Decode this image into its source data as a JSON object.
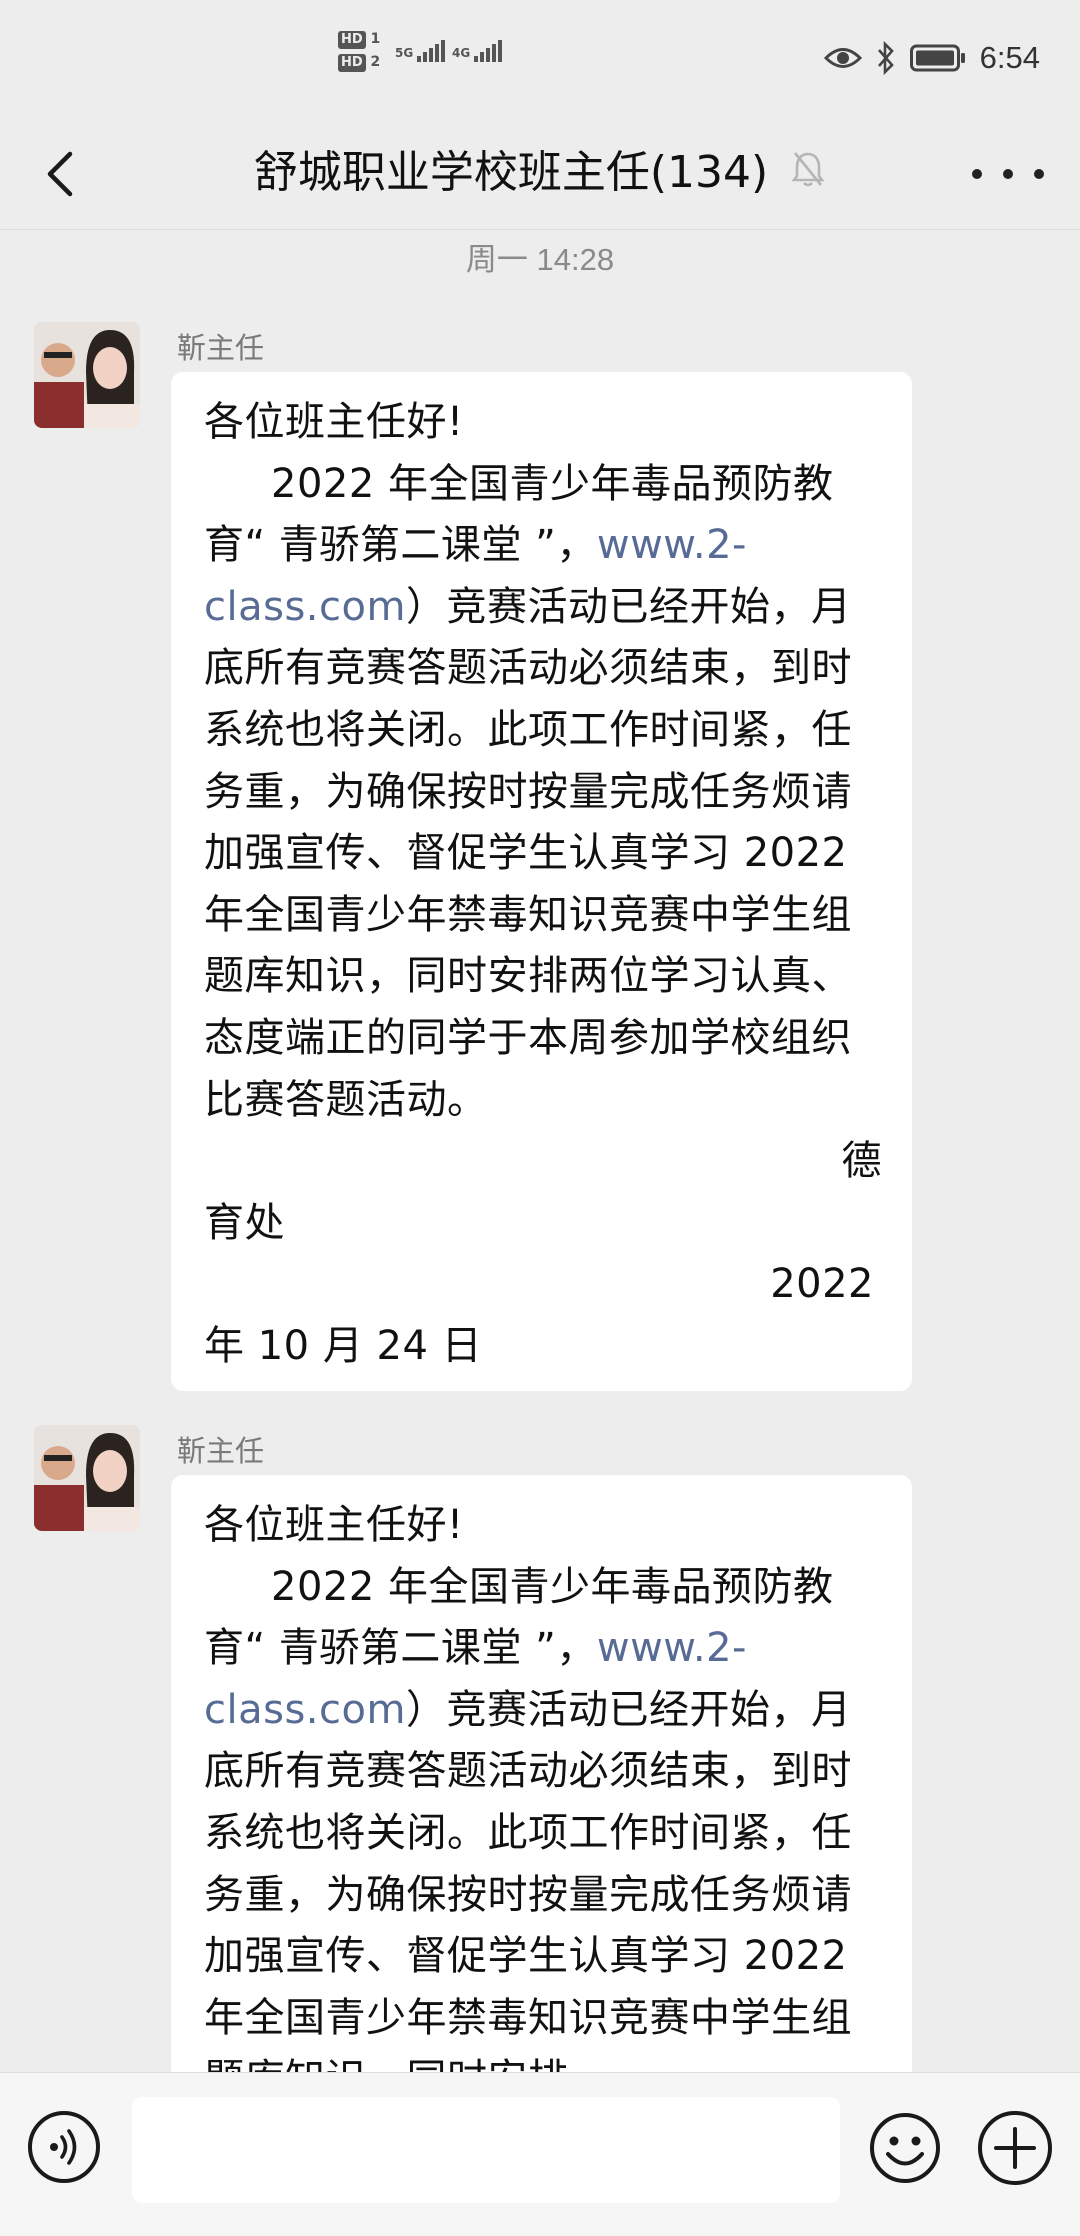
{
  "status_bar": {
    "sim1_label": "HD",
    "sim1_num": "1",
    "sim2_label": "HD",
    "sim2_num": "2",
    "net1": "5G",
    "net2": "4G",
    "time": "6:54"
  },
  "header": {
    "title": "舒城职业学校班主任(134)"
  },
  "timestamp": "周一 14:28",
  "messages": [
    {
      "sender": "靳主任",
      "greeting": "各位班主任好!",
      "para_start": "2022 年全国青少年毒品预防教育“ 青骄第二课堂 ”，",
      "link": "www.2-class.com",
      "para_rest": "）竞赛活动已经开始，月底所有竞赛答题活动必须结束，到时系统也将关闭。此项工作时间紧，任务重，为确保按时按量完成任务烦请加强宣传、督促学生认真学习 2022 年全国青少年禁毒知识竞赛中学生组题库知识，同时安排两位学习认真、态度端正的同学于本周参加学校组织比赛答题活动。",
      "sign_a": "德",
      "sign_b": "育处",
      "date_a": "2022",
      "date_b": "年 10 月 24 日"
    },
    {
      "sender": "靳主任",
      "greeting": "各位班主任好!",
      "para_start": "2022 年全国青少年毒品预防教育“ 青骄第二课堂 ”，",
      "link": "www.2-class.com",
      "para_rest": "）竞赛活动已经开始，月底所有竞赛答题活动必须结束，到时系统也将关闭。此项工作时间紧，任务重，为确保按时按量完成任务烦请加强宣传、督促学生认真学习 2022 年全国青少年禁毒知识竞赛中学生组题库知识，同时安排"
    }
  ]
}
